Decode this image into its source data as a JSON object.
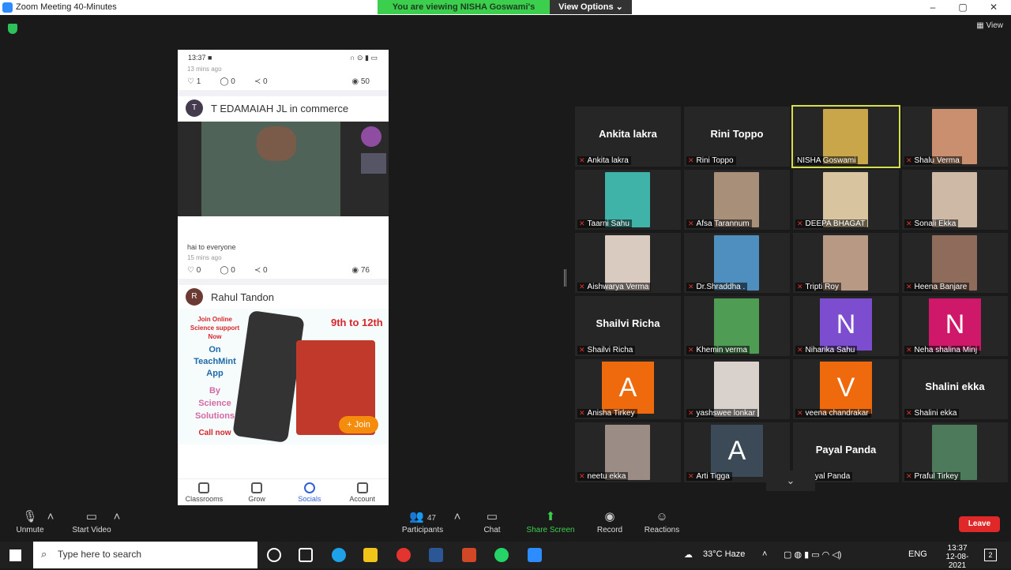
{
  "window": {
    "title": "Zoom Meeting 40-Minutes",
    "minimize": "–",
    "maximize": "▢",
    "close": "✕"
  },
  "banner": {
    "viewing": "You are viewing NISHA Goswami's screen",
    "options": "View Options ⌄"
  },
  "view_button": "View",
  "phone": {
    "status_time": "13:37",
    "post1": {
      "time": "13 mins ago",
      "likes": "1",
      "comments": "0",
      "shares": "0",
      "views": "50"
    },
    "post2": {
      "avatar": "T",
      "author": "T EDAMAIAH JL in commerce",
      "text": "hai to everyone",
      "time": "15 mins ago",
      "likes": "0",
      "comments": "0",
      "shares": "0",
      "views": "76"
    },
    "post3": {
      "avatar": "R",
      "author": "Rahul Tandon"
    },
    "promo": {
      "line1": "Join Online",
      "line2": "Science support",
      "line3": "Now",
      "on": "On",
      "app": "TeachMint",
      "app2": "App",
      "by": "By",
      "by2": "Science",
      "by3": "Solutions",
      "call": "Call now",
      "grades": "9th to 12th",
      "join": "+ Join"
    },
    "nav": [
      "Classrooms",
      "Grow",
      "Socials",
      "Account"
    ]
  },
  "participants": [
    {
      "name": "Ankita lakra",
      "big": "Ankita lakra"
    },
    {
      "name": "Rini Toppo",
      "big": "Rini Toppo"
    },
    {
      "name": "NISHA Goswami",
      "photo": "#c9a64a"
    },
    {
      "name": "Shalu Verma",
      "photo": "#c98f6e"
    },
    {
      "name": "Taarni Sahu",
      "photo": "#3fb3a8"
    },
    {
      "name": "Afsa Tarannum",
      "photo": "#a88f7a"
    },
    {
      "name": "DEEPA BHAGAT",
      "photo": "#d9c4a0"
    },
    {
      "name": "Sonali Ekka",
      "photo": "#cdb9a6"
    },
    {
      "name": "Aishwarya Verma",
      "photo": "#d9cbc0"
    },
    {
      "name": "Dr.Shraddha .",
      "photo": "#4f8fbf"
    },
    {
      "name": "Tripti Roy",
      "photo": "#b89a84"
    },
    {
      "name": "Heena Banjare",
      "photo": "#8e6b5a"
    },
    {
      "name": "Shailvi Richa",
      "big": "Shailvi Richa"
    },
    {
      "name": "Khemin verma",
      "photo": "#4f9c54"
    },
    {
      "name": "Niharika Sahu",
      "letter": "N",
      "color": "#7c4dcf"
    },
    {
      "name": "Neha shalina Minj",
      "letter": "N",
      "color": "#d0186a"
    },
    {
      "name": "Anisha Tirkey",
      "letter": "A",
      "color": "#ee6a0c"
    },
    {
      "name": "yashswee lonkar",
      "photo": "#d9d2cc"
    },
    {
      "name": "veena chandrakar",
      "letter": "V",
      "color": "#ee6a0c"
    },
    {
      "name": "Shalini ekka",
      "big": "Shalini ekka"
    },
    {
      "name": "neetu ekka",
      "photo": "#9b8c86"
    },
    {
      "name": "Arti Tigga",
      "letter": "A",
      "color": "#3b4a56"
    },
    {
      "name": "Payal Panda",
      "big": "Payal Panda"
    },
    {
      "name": "Praful Tirkey",
      "photo": "#4e7a5c"
    }
  ],
  "toolbar": {
    "unmute": "Unmute",
    "start_video": "Start Video",
    "participants": "Participants",
    "participants_count": "47",
    "chat": "Chat",
    "share": "Share Screen",
    "record": "Record",
    "reactions": "Reactions",
    "leave": "Leave"
  },
  "taskbar": {
    "search_placeholder": "Type here to search",
    "weather": "33°C  Haze",
    "lang": "ENG",
    "time": "13:37",
    "date": "12-08-2021",
    "notif": "2"
  }
}
